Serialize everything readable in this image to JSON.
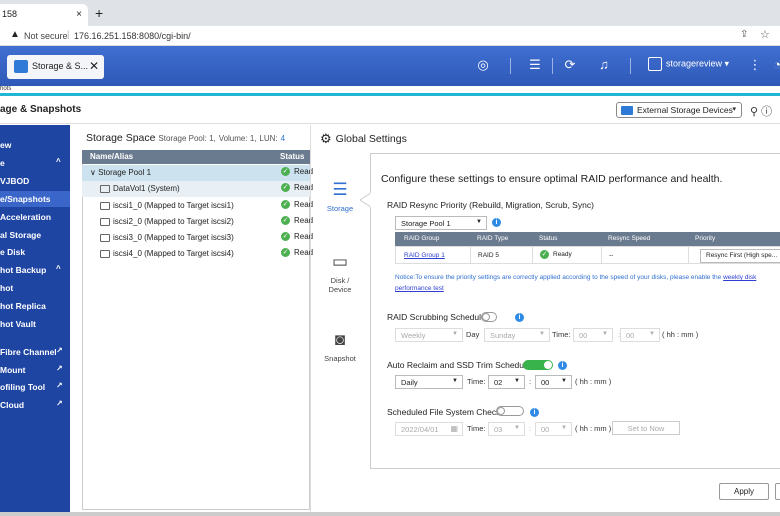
{
  "browser": {
    "tab_title": "158",
    "tab_close": "×",
    "new_tab": "+",
    "not_secure": "Not secure",
    "separator": "|",
    "url": "176.16.251.158:8080/cgi-bin/"
  },
  "topbar": {
    "app_tab_label": "Storage & S...",
    "app_tab_close": "✕",
    "username": "storagereview",
    "user_dropdown": "▾",
    "subhint": "hots"
  },
  "app": {
    "title": "age & Snapshots",
    "external_devices_label": "External Storage Devices",
    "external_devices_dd": "▾"
  },
  "nav": {
    "items": [
      {
        "label": "ew",
        "arrow": ""
      },
      {
        "label": "e",
        "arrow": "^"
      },
      {
        "label": "VJBOD",
        "arrow": ""
      },
      {
        "label": "e/Snapshots",
        "arrow": ""
      },
      {
        "label": "Acceleration",
        "arrow": ""
      },
      {
        "label": "al Storage",
        "arrow": ""
      },
      {
        "label": "e Disk",
        "arrow": ""
      },
      {
        "label": "hot Backup",
        "arrow": "^"
      },
      {
        "label": "hot",
        "arrow": ""
      },
      {
        "label": "hot Replica",
        "arrow": ""
      },
      {
        "label": "hot Vault",
        "arrow": ""
      },
      {
        "label": "Fibre Channel",
        "arrow": "↗"
      },
      {
        "label": "Mount",
        "arrow": "↗"
      },
      {
        "label": "ofiling Tool",
        "arrow": "↗"
      },
      {
        "label": "Cloud",
        "arrow": "↗"
      }
    ]
  },
  "storage_space": {
    "title": "Storage Space",
    "sub_pool_label": "Storage Pool: 1,",
    "sub_volume_label": "Volume: 1,",
    "sub_lun_label": "LUN:",
    "sub_lun_value": "4",
    "col_name": "Name/Alias",
    "col_status": "Status",
    "rows": [
      {
        "name": "Storage Pool 1",
        "status": "Read"
      },
      {
        "name": "DataVol1 (System)",
        "status": "Read"
      },
      {
        "name": "iscsi1_0 (Mapped to Target iscsi1)",
        "status": "Read"
      },
      {
        "name": "iscsi2_0 (Mapped to Target iscsi2)",
        "status": "Read"
      },
      {
        "name": "iscsi3_0 (Mapped to Target iscsi3)",
        "status": "Read"
      },
      {
        "name": "iscsi4_0 (Mapped to Target iscsi4)",
        "status": "Read"
      }
    ]
  },
  "global_settings": {
    "title": "Global Settings",
    "tabs": [
      "Storage",
      "Disk /\nDevice",
      "Snapshot"
    ],
    "description": "Configure these settings to ensure optimal RAID performance and health.",
    "resync": {
      "heading": "RAID Resync Priority (Rebuild, Migration, Scrub, Sync)",
      "pool_select": "Storage Pool 1",
      "columns": [
        "RAID Group",
        "RAID Type",
        "Status",
        "Resync Speed",
        "Priority"
      ],
      "row": {
        "group": "RAID Group 1",
        "type": "RAID 5",
        "status": "Ready",
        "speed": "--",
        "priority": "Resync First (High spe..."
      },
      "notice_text": "Notice:To ensure the priority settings are correctly applied according to the speed of your disks, please enable the",
      "notice_link": "weekly disk",
      "notice_link2": "performance test"
    },
    "scrubbing": {
      "heading": "RAID Scrubbing Schedule",
      "freq": "Weekly",
      "day_label": "Day",
      "day": "Sunday",
      "time_label": "Time:",
      "hour": "00",
      "minute": "00",
      "hint": "( hh : mm )",
      "colon": ":"
    },
    "reclaim": {
      "heading": "Auto Reclaim and SSD Trim Schedule",
      "freq": "Daily",
      "time_label": "Time:",
      "hour": "02",
      "minute": "00",
      "hint": "( hh : mm )",
      "colon": ":"
    },
    "fscheck": {
      "heading": "Scheduled File System Check",
      "date": "2022/04/01",
      "time_label": "Time:",
      "hour": "03",
      "minute": "00",
      "hint": "( hh : mm )",
      "colon": ":",
      "set_now": "Set to Now"
    },
    "apply_label": "Apply"
  },
  "colors": {
    "nav_bg": "#1f45a3",
    "topbar": "#2f59b8",
    "accent": "#2f6fd1",
    "toggle_on": "#38b24a"
  }
}
